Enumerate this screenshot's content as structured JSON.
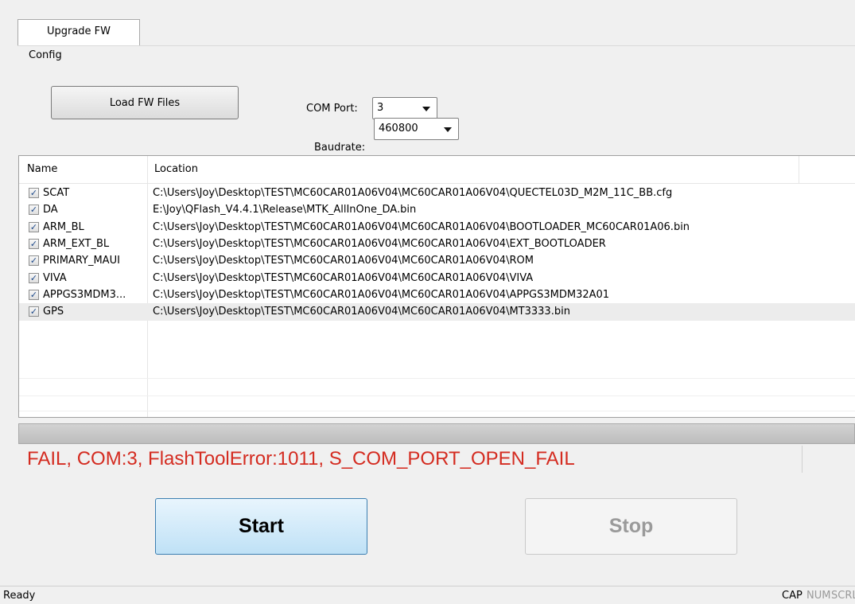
{
  "tab": {
    "label": "Upgrade FW"
  },
  "config": {
    "group_label": "Config",
    "load_button": "Load FW Files",
    "com_port_label": "COM Port:",
    "com_port_value": "3",
    "baudrate_label": "Baudrate:",
    "baudrate_value": "460800"
  },
  "table": {
    "columns": [
      "Name",
      "Location"
    ],
    "rows": [
      {
        "checked": true,
        "name": "SCAT",
        "location": "C:\\Users\\Joy\\Desktop\\TEST\\MC60CAR01A06V04\\MC60CAR01A06V04\\QUECTEL03D_M2M_11C_BB.cfg"
      },
      {
        "checked": true,
        "name": "DA",
        "location": "E:\\Joy\\QFlash_V4.4.1\\Release\\MTK_AllInOne_DA.bin"
      },
      {
        "checked": true,
        "name": "ARM_BL",
        "location": "C:\\Users\\Joy\\Desktop\\TEST\\MC60CAR01A06V04\\MC60CAR01A06V04\\BOOTLOADER_MC60CAR01A06.bin"
      },
      {
        "checked": true,
        "name": "ARM_EXT_BL",
        "location": "C:\\Users\\Joy\\Desktop\\TEST\\MC60CAR01A06V04\\MC60CAR01A06V04\\EXT_BOOTLOADER"
      },
      {
        "checked": true,
        "name": "PRIMARY_MAUI",
        "location": "C:\\Users\\Joy\\Desktop\\TEST\\MC60CAR01A06V04\\MC60CAR01A06V04\\ROM"
      },
      {
        "checked": true,
        "name": "VIVA",
        "location": "C:\\Users\\Joy\\Desktop\\TEST\\MC60CAR01A06V04\\MC60CAR01A06V04\\VIVA"
      },
      {
        "checked": true,
        "name": "APPGS3MDM3...",
        "location": "C:\\Users\\Joy\\Desktop\\TEST\\MC60CAR01A06V04\\MC60CAR01A06V04\\APPGS3MDM32A01"
      },
      {
        "checked": true,
        "name": "GPS",
        "location": "C:\\Users\\Joy\\Desktop\\TEST\\MC60CAR01A06V04\\MC60CAR01A06V04\\MT3333.bin"
      }
    ]
  },
  "status_message": "FAIL, COM:3, FlashToolError:1011, S_COM_PORT_OPEN_FAIL",
  "buttons": {
    "start": "Start",
    "stop": "Stop"
  },
  "statusbar": {
    "text": "Ready",
    "cap": "CAP",
    "num": "NUM",
    "scrl": "SCRL"
  },
  "colors": {
    "error_text": "#d42b20",
    "start_button": "#bfe1f6",
    "disabled_text": "#9a9a9a"
  }
}
